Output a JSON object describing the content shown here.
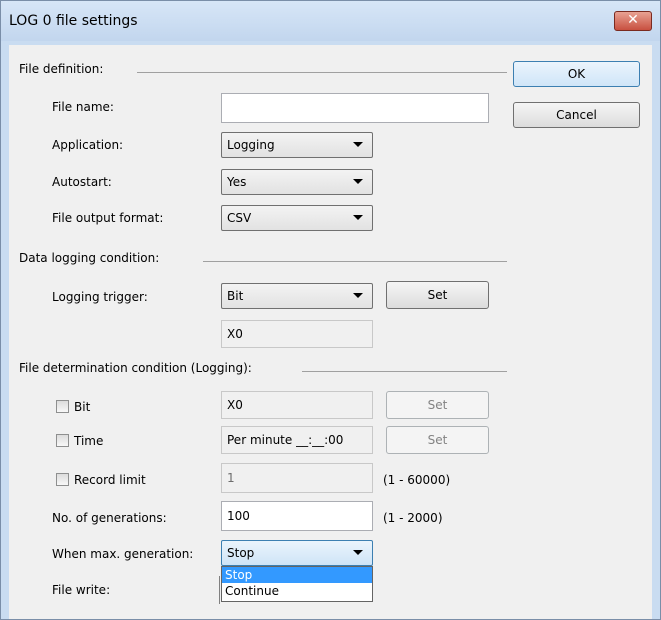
{
  "window": {
    "title": "LOG 0 file settings",
    "close_glyph": "✕",
    "accent": "#c9dcf1"
  },
  "buttons": {
    "ok": "OK",
    "cancel": "Cancel"
  },
  "file_definition": {
    "heading": "File definition:",
    "file_name_label": "File name:",
    "file_name_value": "",
    "application_label": "Application:",
    "application_value": "Logging",
    "autostart_label": "Autostart:",
    "autostart_value": "Yes",
    "format_label": "File output format:",
    "format_value": "CSV"
  },
  "data_logging": {
    "heading": "Data logging condition:",
    "trigger_label": "Logging trigger:",
    "trigger_value": "Bit",
    "set_label": "Set",
    "device_value": "X0"
  },
  "file_determination": {
    "heading": "File determination condition (Logging):",
    "bit_label": "Bit",
    "bit_value": "X0",
    "bit_set": "Set",
    "time_label": "Time",
    "time_value": "Per minute __:__:00",
    "time_set": "Set",
    "record_label": "Record limit",
    "record_value": "1",
    "record_range": "(1 - 60000)",
    "generations_label": "No. of generations:",
    "generations_value": "100",
    "generations_range": "(1 - 2000)",
    "max_gen_label": "When max. generation:",
    "max_gen_value": "Stop",
    "options": [
      "Stop",
      "Continue"
    ],
    "selected_option": "Stop",
    "file_write_label": "File write:"
  }
}
